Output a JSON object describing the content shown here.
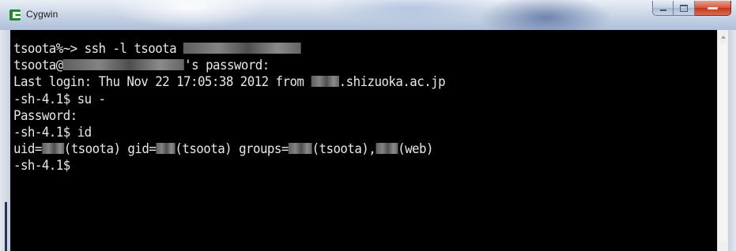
{
  "window": {
    "title": "Cygwin",
    "app_icon": "cygwin-icon"
  },
  "controls": {
    "minimize": "minimize-icon",
    "maximize": "maximize-icon",
    "close": "close-icon"
  },
  "terminal": {
    "background": "#000000",
    "foreground": "#e8e8e8",
    "lines": [
      {
        "parts": [
          {
            "text": "tsoota%~> ssh -l tsoota "
          },
          {
            "redacted": true,
            "width": 160
          }
        ]
      },
      {
        "parts": [
          {
            "text": "tsoota@"
          },
          {
            "redacted": true,
            "width": 165
          },
          {
            "text": "'s password:"
          }
        ]
      },
      {
        "parts": [
          {
            "text": "Last login: Thu Nov 22 17:05:38 2012 from "
          },
          {
            "redacted": true,
            "width": 38
          },
          {
            "text": ".shizuoka.ac.jp"
          }
        ]
      },
      {
        "parts": [
          {
            "text": "-sh-4.1$ su -"
          }
        ]
      },
      {
        "parts": [
          {
            "text": "Password:"
          }
        ]
      },
      {
        "parts": [
          {
            "text": "-sh-4.1$ id"
          }
        ]
      },
      {
        "parts": [
          {
            "text": "uid="
          },
          {
            "redacted": true,
            "width": 30
          },
          {
            "text": "(tsoota) gid="
          },
          {
            "redacted": true,
            "width": 26
          },
          {
            "text": "(tsoota) groups="
          },
          {
            "redacted": true,
            "width": 32
          },
          {
            "text": "(tsoota),"
          },
          {
            "redacted": true,
            "width": 30
          },
          {
            "text": "(web)"
          }
        ]
      },
      {
        "parts": [
          {
            "text": "-sh-4.1$ "
          }
        ]
      }
    ]
  }
}
